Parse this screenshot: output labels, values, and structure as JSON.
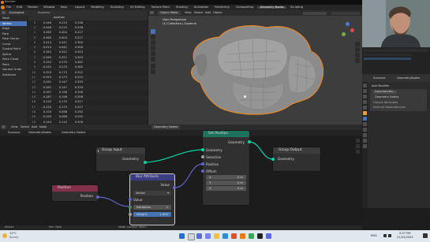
{
  "window": {
    "title": "Blender"
  },
  "menubar": {
    "items": [
      "File",
      "Edit",
      "Render",
      "Window",
      "Help"
    ],
    "workspaces": [
      "Layout",
      "Modeling",
      "Sculpting",
      "UV Editing",
      "Texture Paint",
      "Shading",
      "Animation",
      "Rendering",
      "Compositing",
      "Geometry Nodes",
      "Scripting"
    ],
    "active_workspace": "Geometry Nodes"
  },
  "spreadsheet": {
    "header_mode": "Evaluated",
    "object": "Suzanne",
    "columns": [
      "",
      "position",
      "",
      ""
    ],
    "sidebar": [
      {
        "label": "Mesh",
        "selected": false
      },
      {
        "label": "Vertex",
        "selected": true
      },
      {
        "label": "Edge",
        "selected": false
      },
      {
        "label": "Face",
        "selected": false
      },
      {
        "label": "Face Corner",
        "selected": false
      },
      {
        "label": "Curve",
        "selected": false
      },
      {
        "label": "Control Point",
        "selected": false
      },
      {
        "label": "Spline",
        "selected": false
      },
      {
        "label": "Point Cloud",
        "selected": false
      },
      {
        "label": "Point",
        "selected": false
      },
      {
        "label": "Volume Grids",
        "selected": false
      },
      {
        "label": "Instances",
        "selected": false
      }
    ],
    "rows": [
      [
        "0",
        "0.446",
        "0.215",
        "0.338"
      ],
      [
        "1",
        "-0.446",
        "0.215",
        "0.338"
      ],
      [
        "2",
        "0.460",
        "0.404",
        "0.217"
      ],
      [
        "3",
        "-0.460",
        "0.404",
        "0.217"
      ],
      [
        "4",
        "0.414",
        "0.441",
        "0.300"
      ],
      [
        "5",
        "-0.414",
        "0.441",
        "0.300"
      ],
      [
        "6",
        "0.345",
        "0.321",
        "0.353"
      ],
      [
        "7",
        "-0.345",
        "0.321",
        "0.353"
      ],
      [
        "8",
        "0.252",
        "0.270",
        "0.362"
      ],
      [
        "9",
        "-0.252",
        "0.270",
        "0.362"
      ],
      [
        "10",
        "0.353",
        "0.173",
        "0.312"
      ],
      [
        "11",
        "-0.353",
        "0.173",
        "0.312"
      ],
      [
        "12",
        "0.281",
        "0.147",
        "0.333"
      ],
      [
        "13",
        "-0.281",
        "0.147",
        "0.333"
      ],
      [
        "14",
        "0.287",
        "0.198",
        "0.358"
      ],
      [
        "15",
        "-0.287",
        "0.198",
        "0.358"
      ],
      [
        "16",
        "0.220",
        "0.179",
        "0.317"
      ],
      [
        "17",
        "-0.220",
        "0.179",
        "0.317"
      ],
      [
        "18",
        "0.190",
        "0.066",
        "0.292"
      ],
      [
        "19",
        "-0.190",
        "0.066",
        "0.292"
      ],
      [
        "20",
        "0.144",
        "0.110",
        "0.306"
      ],
      [
        "21",
        "-0.144",
        "0.110",
        "0.306"
      ]
    ],
    "footer": "Rows: 507  |  Columns: 1"
  },
  "viewport": {
    "mode": "Object Mode",
    "menu": [
      "View",
      "Select",
      "Add",
      "Object"
    ],
    "info_line1": "User Perspective",
    "info_line2": "(1) Collection | Suzanne"
  },
  "properties": {
    "object_name": "Suzanne",
    "modifier_tab": "GeometryNodes",
    "modifier_name": "GeometryNo...",
    "panel_title": "Add Modifier",
    "node_group": "Geometry Nodes",
    "output_attributes": "Output Attributes",
    "internal_dependencies": "Internal Dependencies"
  },
  "node_editor": {
    "menu": [
      "View",
      "Select",
      "Add",
      "Node"
    ],
    "tree_name": "Geometry Nodes",
    "breadcrumb": [
      "Suzanne",
      "GeometryNodes",
      "Geometry Nodes"
    ],
    "nodes": {
      "group_input": {
        "title": "Group Input",
        "out": "Geometry"
      },
      "set_position": {
        "title": "Set Position",
        "out": "Geometry",
        "in_geometry": "Geometry",
        "selection": "Selection",
        "position": "Position",
        "offset": "Offset:",
        "x_label": "X",
        "y_label": "Y",
        "z_label": "Z",
        "x": "0 m",
        "y": "0 m",
        "z": "0 m"
      },
      "group_output": {
        "title": "Group Output",
        "in": "Geometry"
      },
      "position": {
        "title": "Position",
        "out": "Position"
      },
      "blur_attribute": {
        "title": "Blur Attribute",
        "out": "Value",
        "type": "Vector",
        "in_value": "Value",
        "iterations_label": "Iterations",
        "iterations": "1",
        "weight_label": "Weight",
        "weight": "1.000"
      }
    },
    "colors": {
      "geometry": "#00d6a3",
      "vector": "#6363c7",
      "set_position_header": "#1d725e",
      "position_header": "#83314a",
      "blur_header": "#3c3c83"
    }
  },
  "statusbar": {
    "left": "Select",
    "mid": "Pan View",
    "right": "Node Context Menu"
  },
  "taskbar": {
    "weather_temp": "13°C",
    "weather_desc": "Sunny",
    "search": "Search",
    "time": "5:57 PM",
    "date": "21/02/2022",
    "lang": "ENG"
  }
}
